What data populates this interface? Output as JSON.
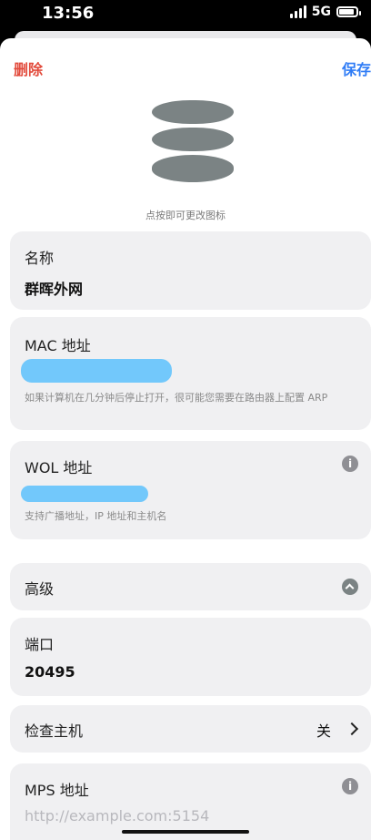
{
  "status": {
    "time": "13:56",
    "network": "5G"
  },
  "nav": {
    "delete": "删除",
    "save": "保存"
  },
  "icon": {
    "name": "database-icon",
    "hint": "点按即可更改图标"
  },
  "name_card": {
    "label": "名称",
    "value": "群晖外网"
  },
  "mac_card": {
    "label": "MAC 地址",
    "hint": "如果计算机在几分钟后停止打开，很可能您需要在路由器上配置 ARP"
  },
  "wol_card": {
    "label": "WOL 地址",
    "hint": "支持广播地址，IP 地址和主机名"
  },
  "advanced": {
    "label": "高级"
  },
  "port_card": {
    "label": "端口",
    "value": "20495"
  },
  "check_host": {
    "label": "检查主机",
    "value": "关"
  },
  "mps_card": {
    "label": "MPS 地址",
    "placeholder": "http://example.com:5154"
  },
  "colors": {
    "destructive": "#e24a3b",
    "accent": "#2f7cf6",
    "redaction": "#72c8fb"
  }
}
